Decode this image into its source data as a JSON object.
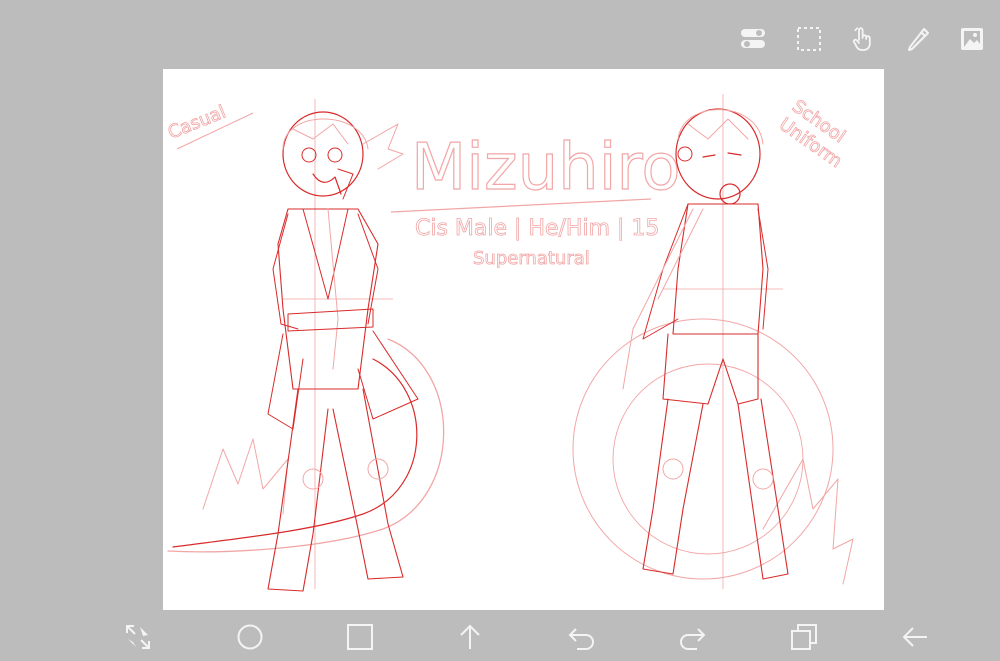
{
  "colors": {
    "background": "#bcbcbc",
    "canvas": "#ffffff",
    "icon": "#f4f4f4",
    "sketch_dark": "#d92b2b",
    "sketch_light": "#f2a6a6"
  },
  "toolbar_top": [
    {
      "name": "layer-toggle-icon"
    },
    {
      "name": "selection-icon"
    },
    {
      "name": "hand-tool-icon"
    },
    {
      "name": "pen-tool-icon"
    },
    {
      "name": "image-import-icon"
    }
  ],
  "toolbar_bottom": [
    {
      "name": "transform-icon"
    },
    {
      "name": "circle-shape-icon"
    },
    {
      "name": "square-shape-icon"
    },
    {
      "name": "upload-icon"
    },
    {
      "name": "undo-icon"
    },
    {
      "name": "redo-icon"
    },
    {
      "name": "layers-icon"
    },
    {
      "name": "back-icon"
    }
  ],
  "drawing": {
    "title": "Mizuhiro",
    "subtitle": "Cis Male | He/Him | 15",
    "category": "Supernatural",
    "left_label": "Casual",
    "right_label_line1": "School",
    "right_label_line2": "Uniform"
  }
}
